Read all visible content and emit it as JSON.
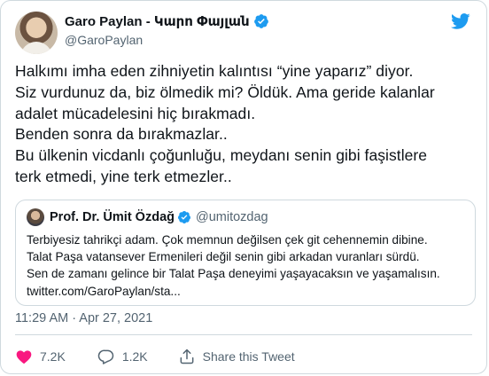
{
  "author": {
    "name": "Garo Paylan - Կարո Փայլան",
    "handle": "@GaroPaylan"
  },
  "tweet": {
    "lines": [
      "Halkımı imha eden zihniyetin kalıntısı “yine yaparız” diyor.",
      "Siz vurdunuz da, biz ölmedik mi? Öldük. Ama geride kalanlar",
      "adalet mücadelesini hiç bırakmadı.",
      "Benden sonra da bırakmazlar..",
      "Bu ülkenin vicdanlı çoğunluğu, meydanı senin gibi faşistlere",
      "terk etmedi, yine terk etmezler.."
    ]
  },
  "quote": {
    "name": "Prof. Dr. Ümit Özdağ",
    "handle": "@umitozdag",
    "lines": [
      "Terbiyesiz tahrikçi adam. Çok memnun değilsen çek git cehennemin dibine.",
      "Talat Paşa vatansever Ermenileri değil senin gibi arkadan vuranları sürdü.",
      "Sen de zamanı gelince bir Talat Paşa deneyimi yaşayacaksın ve yaşamalısın.",
      "twitter.com/GaroPaylan/sta..."
    ]
  },
  "meta": {
    "time": "11:29 AM · Apr 27, 2021"
  },
  "actions": {
    "likes": "7.2K",
    "replies": "1.2K",
    "share_label": "Share this Tweet"
  },
  "colors": {
    "twitter_blue": "#1d9bf0",
    "like_red": "#f91880",
    "secondary_text": "#536471",
    "border": "#cfd9de"
  },
  "icons": [
    "verified-badge-icon",
    "twitter-bird-icon",
    "heart-icon",
    "reply-icon",
    "share-icon"
  ]
}
